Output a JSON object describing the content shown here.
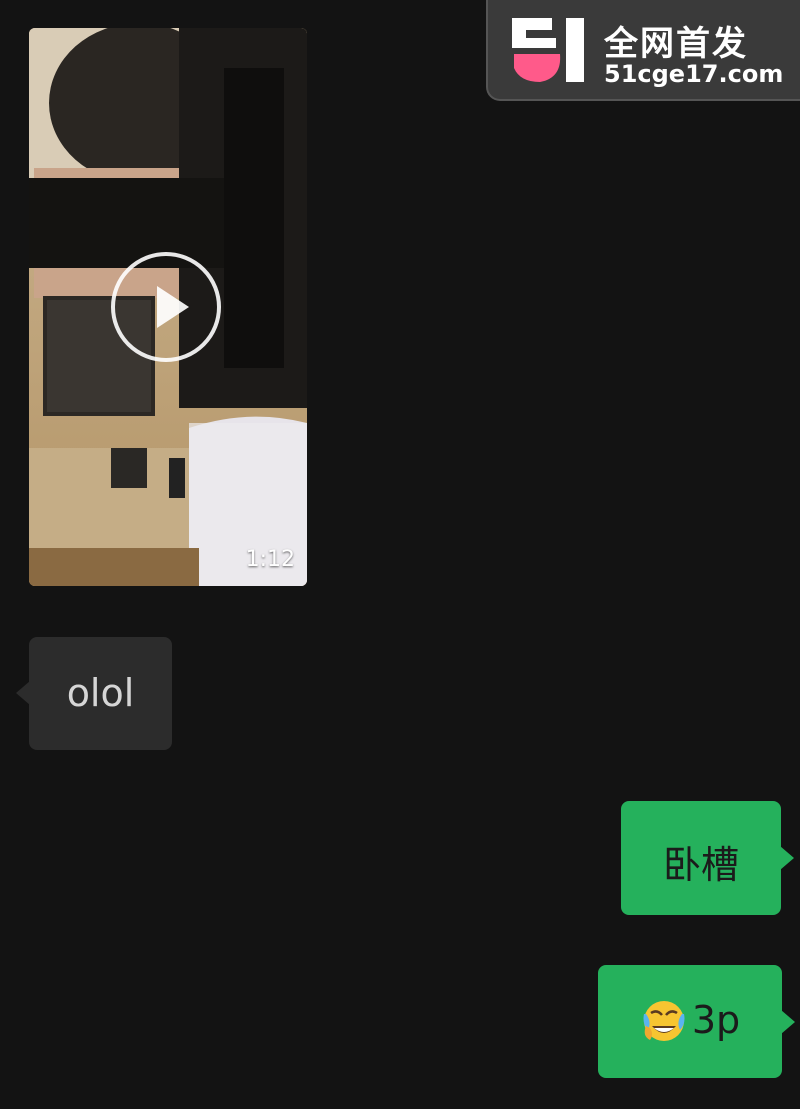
{
  "watermark": {
    "title": "全网首发",
    "domain": "51cge17.com",
    "logo_icon": "51-logo-icon"
  },
  "messages": [
    {
      "type": "video",
      "direction": "incoming",
      "duration": "1:12",
      "icon": "play-icon"
    },
    {
      "type": "text",
      "direction": "incoming",
      "text": "olol"
    },
    {
      "type": "text",
      "direction": "outgoing",
      "text": "卧槽"
    },
    {
      "type": "text",
      "direction": "outgoing",
      "emoji": "face-with-tears-of-joy-icon",
      "text": "3p"
    }
  ],
  "colors": {
    "background": "#131313",
    "incoming_bubble": "#2c2c2c",
    "outgoing_bubble": "#25b15c"
  }
}
